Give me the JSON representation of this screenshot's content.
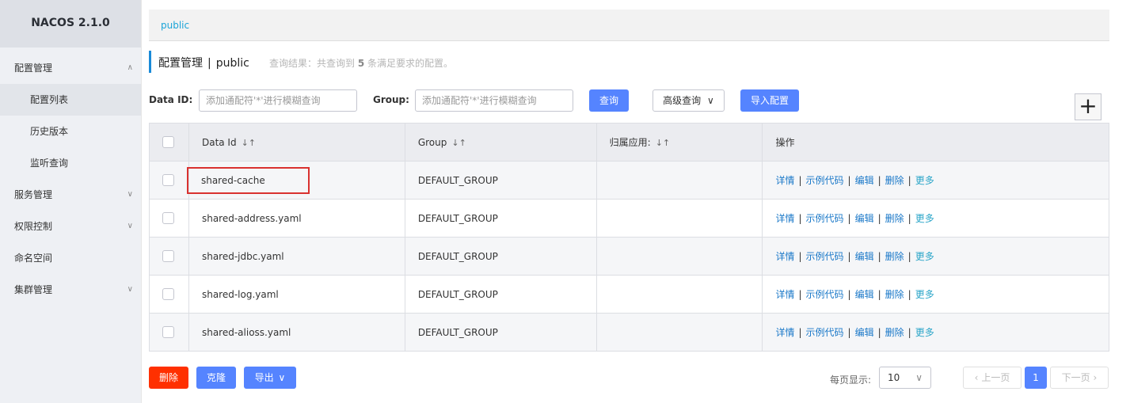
{
  "sidebar": {
    "brand": "NACOS 2.1.0",
    "items": [
      {
        "label": "配置管理",
        "chevron": "∧"
      },
      {
        "label": "配置列表"
      },
      {
        "label": "历史版本"
      },
      {
        "label": "监听查询"
      },
      {
        "label": "服务管理",
        "chevron": "∨"
      },
      {
        "label": "权限控制",
        "chevron": "∨"
      },
      {
        "label": "命名空间"
      },
      {
        "label": "集群管理",
        "chevron": "∨"
      }
    ]
  },
  "namespace_bar": {
    "current": "public"
  },
  "title": {
    "main": "配置管理",
    "sep": "|",
    "namespace": "public",
    "hint_prefix": "查询结果：共查询到",
    "hint_count": "5",
    "hint_suffix": "条满足要求的配置。"
  },
  "search": {
    "dataid_label": "Data ID:",
    "dataid_placeholder": "添加通配符'*'进行模糊查询",
    "group_label": "Group:",
    "group_placeholder": "添加通配符'*'进行模糊查询",
    "query_button": "查询",
    "advanced_button": "高级查询",
    "import_button": "导入配置",
    "add_button": "+"
  },
  "table": {
    "headers": [
      "Data Id",
      "Group",
      "归属应用:",
      "操作"
    ],
    "sort_icon": "↓↑",
    "rows": [
      {
        "data_id": "shared-cache",
        "group": "DEFAULT_GROUP",
        "app": ""
      },
      {
        "data_id": "shared-address.yaml",
        "group": "DEFAULT_GROUP",
        "app": ""
      },
      {
        "data_id": "shared-jdbc.yaml",
        "group": "DEFAULT_GROUP",
        "app": ""
      },
      {
        "data_id": "shared-log.yaml",
        "group": "DEFAULT_GROUP",
        "app": ""
      },
      {
        "data_id": "shared-alioss.yaml",
        "group": "DEFAULT_GROUP",
        "app": ""
      }
    ],
    "actions": {
      "detail": "详情",
      "sample": "示例代码",
      "edit": "编辑",
      "delete": "删除",
      "more": "更多"
    }
  },
  "bottom": {
    "delete_button": "删除",
    "clone_button": "克隆",
    "export_button": "导出",
    "page_size_label": "每页显示:",
    "page_size": "10",
    "prev": "上一页",
    "current_page": "1",
    "next": "下一页"
  },
  "colors": {
    "primary": "#5584ff",
    "danger": "#ff3000",
    "link": "#1a78c8",
    "highlight_box": "#d9312f"
  }
}
